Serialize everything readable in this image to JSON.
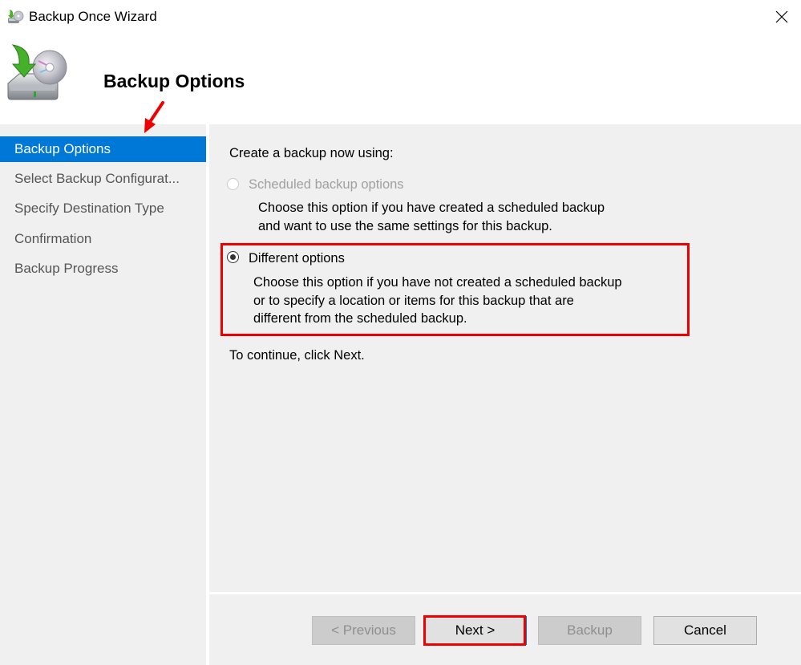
{
  "window": {
    "title": "Backup Once Wizard",
    "icon": "backup-drive-icon",
    "close_icon": "close-icon"
  },
  "header": {
    "title": "Backup Options",
    "icon": "backup-drive-disc-icon"
  },
  "sidebar": {
    "items": [
      {
        "label": "Backup Options",
        "active": true
      },
      {
        "label": "Select Backup Configurat...",
        "active": false
      },
      {
        "label": "Specify Destination Type",
        "active": false
      },
      {
        "label": "Confirmation",
        "active": false
      },
      {
        "label": "Backup Progress",
        "active": false
      }
    ]
  },
  "main": {
    "prompt": "Create a backup now using:",
    "options": [
      {
        "label": "Scheduled backup options",
        "description_lines": [
          "Choose this option if you have created a scheduled backup",
          "and want to use the same settings for this backup."
        ],
        "enabled": false,
        "selected": false
      },
      {
        "label": "Different options",
        "description_lines": [
          "Choose this option if you have not created a scheduled backup",
          "or to specify a location or items for this backup that are",
          "different from the scheduled backup."
        ],
        "enabled": true,
        "selected": true
      }
    ],
    "continue_text": "To continue, click Next."
  },
  "footer": {
    "previous_label": "< Previous",
    "next_label": "Next >",
    "backup_label": "Backup",
    "cancel_label": "Cancel"
  },
  "annotations": {
    "highlight_color": "#ee0000",
    "accent_color": "#0078d7"
  }
}
